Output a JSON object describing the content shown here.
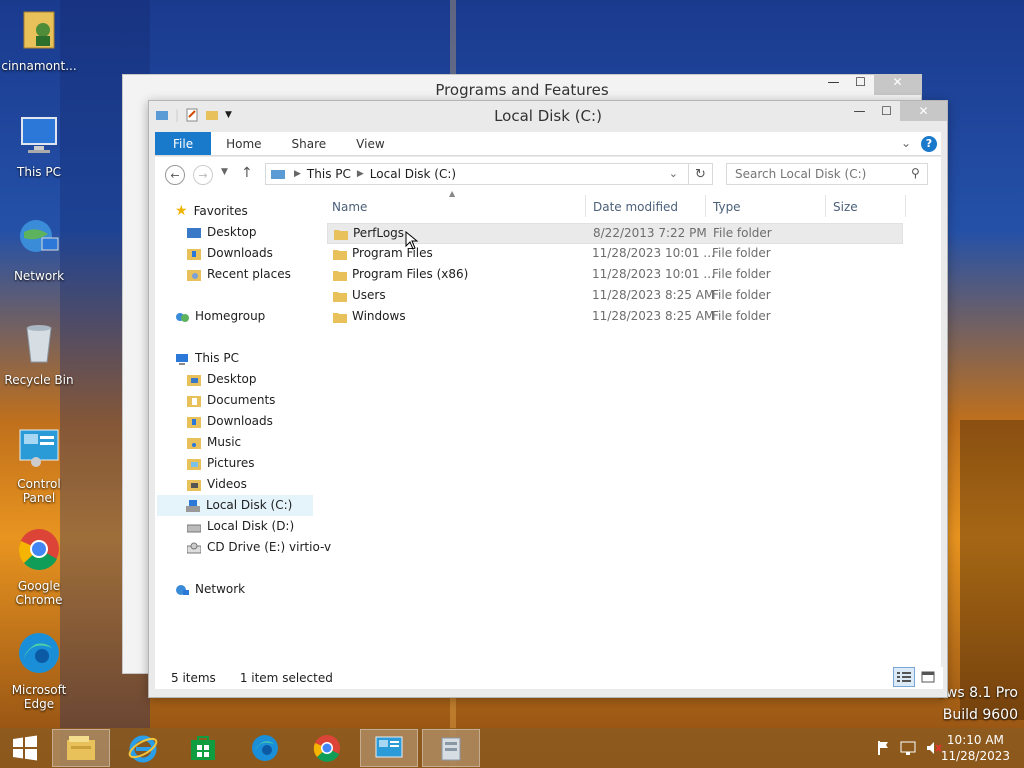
{
  "desktop": {
    "icons": [
      {
        "label": "cinnamont...",
        "icon": "user-folder-icon"
      },
      {
        "label": "This PC",
        "icon": "computer-icon"
      },
      {
        "label": "Network",
        "icon": "network-icon"
      },
      {
        "label": "Recycle Bin",
        "icon": "recycle-bin-icon"
      },
      {
        "label": "Control Panel",
        "icon": "control-panel-icon"
      },
      {
        "label": "Google Chrome",
        "icon": "chrome-icon"
      },
      {
        "label": "Microsoft Edge",
        "icon": "edge-icon"
      }
    ],
    "watermark": {
      "line1": "ows 8.1 Pro",
      "line2": "Build 9600"
    }
  },
  "back_window": {
    "title": "Programs and Features"
  },
  "window": {
    "title": "Local Disk (C:)",
    "controls": {
      "minimize": "—",
      "maximize": "☐",
      "close": "✕"
    },
    "ribbon_tabs": [
      "File",
      "Home",
      "Share",
      "View"
    ],
    "address": {
      "crumbs": [
        "This PC",
        "Local Disk (C:)"
      ]
    },
    "search": {
      "placeholder": "Search Local Disk (C:)"
    },
    "nav": {
      "favorites": "Favorites",
      "favorites_items": [
        "Desktop",
        "Downloads",
        "Recent places"
      ],
      "homegroup": "Homegroup",
      "thispc": "This PC",
      "thispc_items": [
        "Desktop",
        "Documents",
        "Downloads",
        "Music",
        "Pictures",
        "Videos",
        "Local Disk (C:)",
        "Local Disk (D:)",
        "CD Drive (E:) virtio-v"
      ],
      "network": "Network"
    },
    "columns": {
      "name": "Name",
      "date": "Date modified",
      "type": "Type",
      "size": "Size"
    },
    "rows": [
      {
        "name": "PerfLogs",
        "date": "8/22/2013 7:22 PM",
        "type": "File folder",
        "size": ""
      },
      {
        "name": "Program Files",
        "date": "11/28/2023 10:01 ...",
        "type": "File folder",
        "size": ""
      },
      {
        "name": "Program Files (x86)",
        "date": "11/28/2023 10:01 ...",
        "type": "File folder",
        "size": ""
      },
      {
        "name": "Users",
        "date": "11/28/2023 8:25 AM",
        "type": "File folder",
        "size": ""
      },
      {
        "name": "Windows",
        "date": "11/28/2023 8:25 AM",
        "type": "File folder",
        "size": ""
      }
    ],
    "status": {
      "count": "5 items",
      "selection": "1 item selected"
    }
  },
  "taskbar": {
    "clock": {
      "time": "10:10 AM",
      "date": "11/28/2023"
    }
  },
  "colors": {
    "accent": "#1979ca",
    "folder": "#e8c15a",
    "selection": "#e5f3fb"
  }
}
